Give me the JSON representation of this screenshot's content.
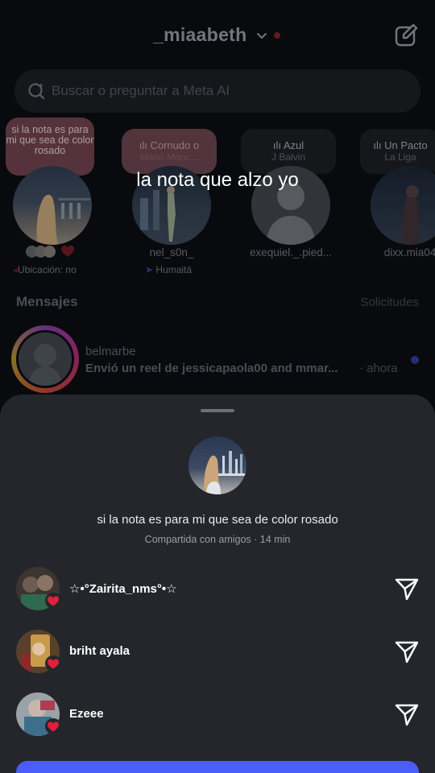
{
  "header": {
    "username": "_miaabeth"
  },
  "search": {
    "placeholder": "Buscar o preguntar a Meta AI"
  },
  "notes": [
    {
      "text": "si la nota es para mi que sea de color rosado"
    },
    {
      "title": "Cornudo o",
      "subtitle": "Mario Monc..."
    },
    {
      "title": "Azul",
      "subtitle": "J Balvin"
    },
    {
      "title": "Un Pacto",
      "subtitle": "La Liga"
    }
  ],
  "stories": [
    {
      "name": "",
      "meta": "Ubicación: no"
    },
    {
      "name": "nel_s0n_",
      "meta": "Humaitá"
    },
    {
      "name": "exequiel._.pied...",
      "meta": ""
    },
    {
      "name": "dixx.mia04",
      "meta": ""
    }
  ],
  "overlay": {
    "caption": "la nota que alzo yo"
  },
  "messages": {
    "heading": "Mensajes",
    "requests": "Solicitudes",
    "items": [
      {
        "name": "belmarbe",
        "preview": "Envió un reel de jessicapaola00 and mmar...",
        "time": "· ahora"
      }
    ]
  },
  "sheet": {
    "note_text": "si la nota es para mi que sea de color rosado",
    "shared_text": "Compartida con amigos · 14 min",
    "reactions": [
      {
        "name": "☆•°Zairita_nms°•☆"
      },
      {
        "name": "briht ayala"
      },
      {
        "name": "Ezeee"
      }
    ]
  },
  "colors": {
    "accent": "#4a5dfb",
    "heart": "#e0213a",
    "pink_note": "#6a3f4a"
  }
}
